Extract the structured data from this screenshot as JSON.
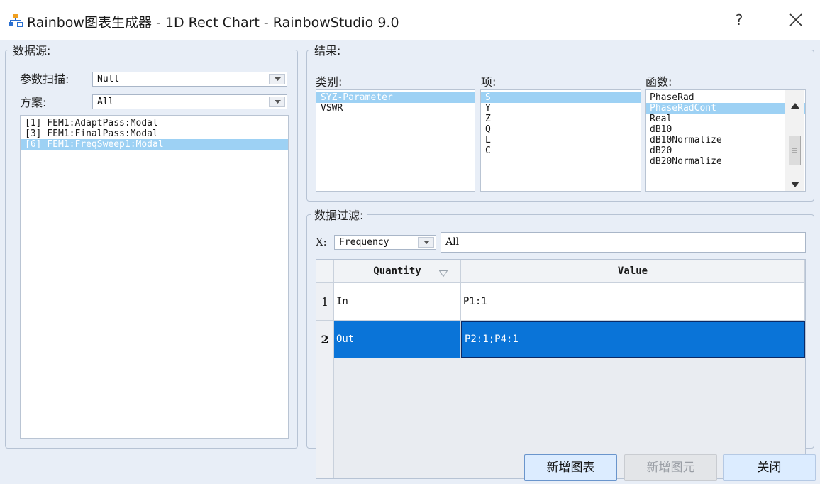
{
  "window": {
    "title": "Rainbow图表生成器 - 1D Rect Chart - RainbowStudio 9.0",
    "help_label": "?"
  },
  "data_source": {
    "legend": "数据源:",
    "sweep_label": "参数扫描:",
    "sweep_value": "Null",
    "scheme_label": "方案:",
    "scheme_value": "All",
    "solutions": [
      {
        "text": "[1] FEM1:AdaptPass:Modal",
        "selected": false
      },
      {
        "text": "[3] FEM1:FinalPass:Modal",
        "selected": false
      },
      {
        "text": "[6] FEM1:FreqSweep1:Modal",
        "selected": true
      }
    ]
  },
  "result": {
    "legend": "结果:",
    "category_label": "类别:",
    "categories": [
      {
        "text": "SYZ-Parameter",
        "selected": true
      },
      {
        "text": "VSWR",
        "selected": false
      }
    ],
    "item_label": "项:",
    "items": [
      {
        "text": "S",
        "selected": true
      },
      {
        "text": "Y",
        "selected": false
      },
      {
        "text": "Z",
        "selected": false
      },
      {
        "text": "Q",
        "selected": false
      },
      {
        "text": "L",
        "selected": false
      },
      {
        "text": "C",
        "selected": false
      }
    ],
    "function_label": "函数:",
    "functions": [
      {
        "text": "PhaseRad",
        "selected": false
      },
      {
        "text": "PhaseRadCont",
        "selected": true
      },
      {
        "text": "Real",
        "selected": false
      },
      {
        "text": "dB10",
        "selected": false
      },
      {
        "text": "dB10Normalize",
        "selected": false
      },
      {
        "text": "dB20",
        "selected": false
      },
      {
        "text": "dB20Normalize",
        "selected": false
      }
    ]
  },
  "filter": {
    "legend": "数据过滤:",
    "x_label": "X:",
    "x_combo_value": "Frequency",
    "x_text_value": "All",
    "columns": [
      "Quantity",
      "Value"
    ],
    "rows": [
      {
        "index": "1",
        "quantity": "In",
        "value": "P1:1",
        "selected": false
      },
      {
        "index": "2",
        "quantity": "Out",
        "value": "P2:1;P4:1",
        "selected": true
      }
    ]
  },
  "buttons": {
    "add_chart": "新增图表",
    "add_element": "新增图元",
    "close": "关闭"
  },
  "colors": {
    "selection_light": "#9dd1f4",
    "selection_dark": "#0a74d8",
    "panel_background": "#e8eef7"
  }
}
